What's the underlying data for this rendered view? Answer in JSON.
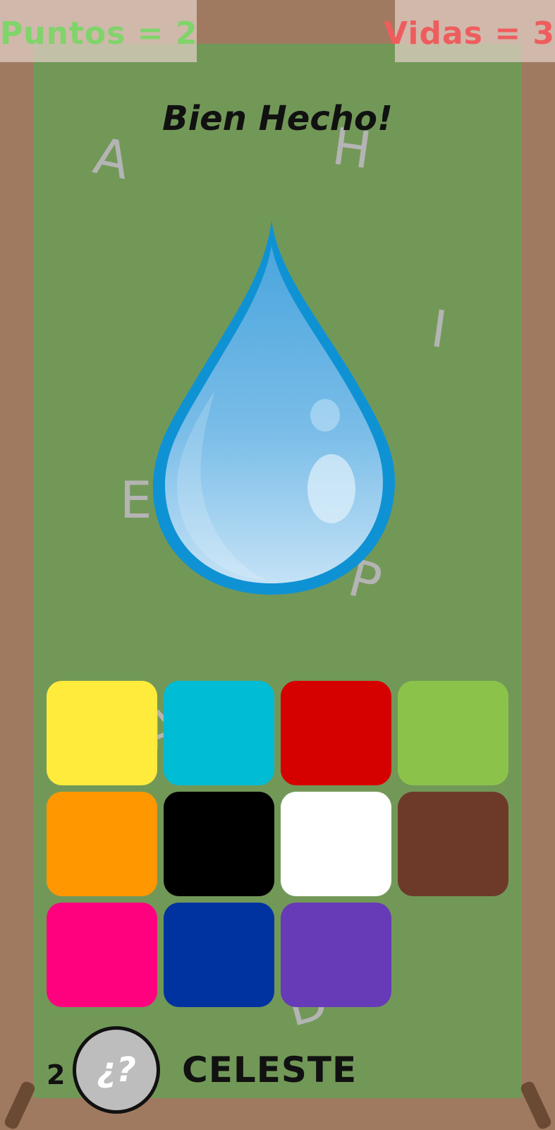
{
  "hud": {
    "score": "Puntos = 2",
    "lives": "Vidas = 3"
  },
  "message": "Bien Hecho!",
  "background_letters": [
    "A",
    "H",
    "I",
    "E",
    "P",
    "D",
    "A"
  ],
  "target_object": "water-drop",
  "palette": {
    "swatches": [
      {
        "name": "yellow",
        "color": "#ffeb3b"
      },
      {
        "name": "cyan",
        "color": "#00bcd4"
      },
      {
        "name": "red",
        "color": "#d50000"
      },
      {
        "name": "light-green",
        "color": "#8bc34a"
      },
      {
        "name": "orange",
        "color": "#ff9800"
      },
      {
        "name": "black",
        "color": "#000000"
      },
      {
        "name": "white",
        "color": "#ffffff"
      },
      {
        "name": "brown",
        "color": "#6d3a2a"
      },
      {
        "name": "pink",
        "color": "#ff007f"
      },
      {
        "name": "dark-blue",
        "color": "#0033a0"
      },
      {
        "name": "purple",
        "color": "#673ab7"
      }
    ]
  },
  "footer": {
    "counter": "2",
    "hint_label": "¿?",
    "color_name": "CELESTE"
  },
  "colors": {
    "board": "#729858",
    "frame": "#a07a60",
    "score_text": "#7fd46a",
    "lives_text": "#ee5d5d"
  }
}
